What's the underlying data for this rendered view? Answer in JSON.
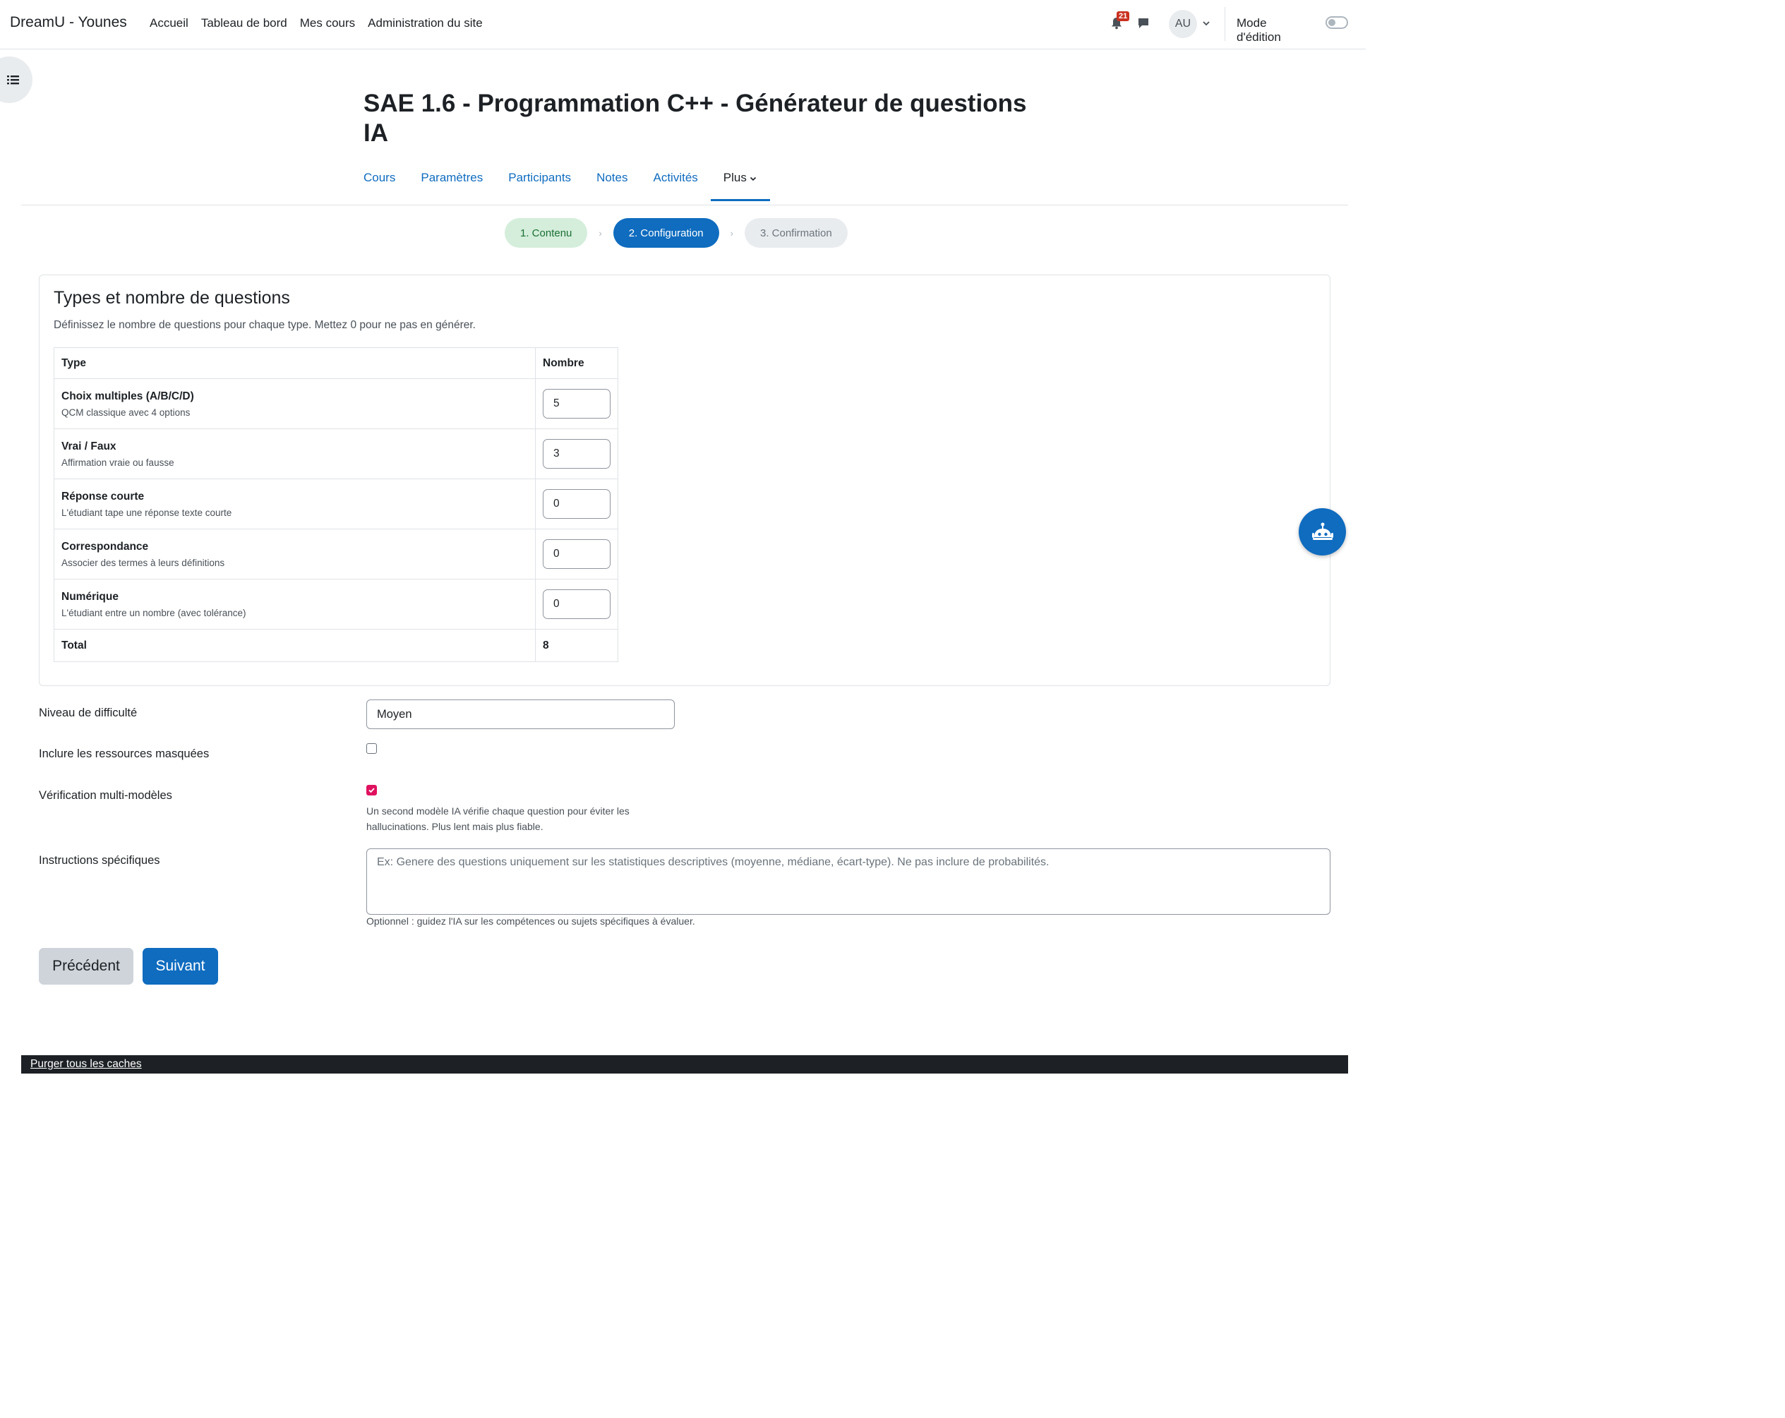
{
  "navbar": {
    "brand": "DreamU - Younes",
    "links": [
      "Accueil",
      "Tableau de bord",
      "Mes cours",
      "Administration du site"
    ],
    "notifications_count": "21",
    "avatar_initials": "AU",
    "edit_mode_label": "Mode d'édition"
  },
  "page": {
    "title": "SAE 1.6 - Programmation C++ - Générateur de questions IA"
  },
  "secondary_nav": {
    "items": [
      "Cours",
      "Paramètres",
      "Participants",
      "Notes",
      "Activités"
    ],
    "more_label": "Plus"
  },
  "steps": [
    "1. Contenu",
    "2. Configuration",
    "3. Confirmation"
  ],
  "questions_card": {
    "title": "Types et nombre de questions",
    "description": "Définissez le nombre de questions pour chaque type. Mettez 0 pour ne pas en générer.",
    "columns": [
      "Type",
      "Nombre"
    ],
    "rows": [
      {
        "name": "Choix multiples (A/B/C/D)",
        "desc": "QCM classique avec 4 options",
        "value": "5"
      },
      {
        "name": "Vrai / Faux",
        "desc": "Affirmation vraie ou fausse",
        "value": "3"
      },
      {
        "name": "Réponse courte",
        "desc": "L'étudiant tape une réponse texte courte",
        "value": "0"
      },
      {
        "name": "Correspondance",
        "desc": "Associer des termes à leurs définitions",
        "value": "0"
      },
      {
        "name": "Numérique",
        "desc": "L'étudiant entre un nombre (avec tolérance)",
        "value": "0"
      }
    ],
    "total_label": "Total",
    "total_value": "8"
  },
  "form": {
    "difficulty_label": "Niveau de difficulté",
    "difficulty_value": "Moyen",
    "hidden_resources_label": "Inclure les ressources masquées",
    "hidden_resources_checked": false,
    "multi_model_label": "Vérification multi-modèles",
    "multi_model_checked": true,
    "multi_model_help_line1": "Un second modèle IA vérifie chaque question pour éviter les",
    "multi_model_help_line2": "hallucinations. Plus lent mais plus fiable.",
    "instructions_label": "Instructions spécifiques",
    "instructions_placeholder": "Ex: Genere des questions uniquement sur les statistiques descriptives (moyenne, médiane, écart-type). Ne pas inclure de probabilités.",
    "instructions_help": "Optionnel : guidez l'IA sur les compétences ou sujets spécifiques à évaluer."
  },
  "buttons": {
    "previous": "Précédent",
    "next": "Suivant"
  },
  "footer": {
    "purge_link": "Purger tous les caches"
  },
  "colors": {
    "primary": "#0f6cbf",
    "step_done_bg": "#d4eedb",
    "checkbox_checked": "#e0115f",
    "footer_bg": "#1d2125"
  }
}
